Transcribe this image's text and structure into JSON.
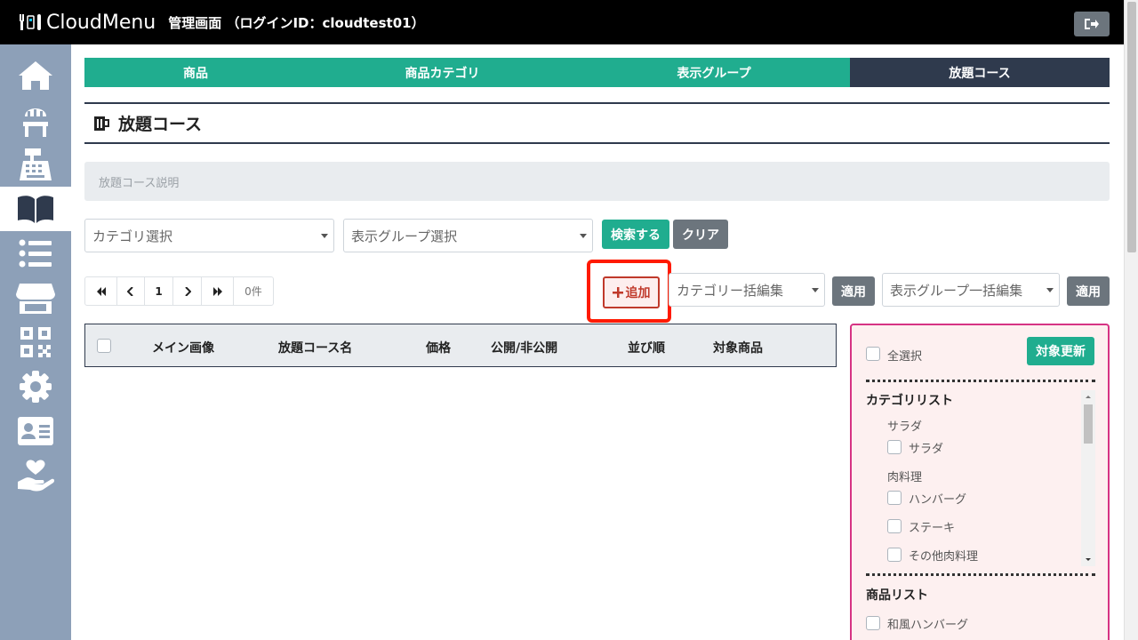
{
  "header": {
    "logo_text": "CloudMenu",
    "title": "管理画面 （ログインID：cloudtest01）"
  },
  "tabs": [
    {
      "label": "商品"
    },
    {
      "label": "商品カテゴリ"
    },
    {
      "label": "表示グループ"
    },
    {
      "label": "放題コース",
      "active": true
    }
  ],
  "page": {
    "title": "放題コース",
    "description_placeholder": "放題コース説明"
  },
  "filters": {
    "category_select": "カテゴリ選択",
    "group_select": "表示グループ選択",
    "search_button": "検索する",
    "clear_button": "クリア"
  },
  "pager": {
    "first": "«",
    "prev": "‹",
    "page": "1",
    "next": "›",
    "last": "»",
    "count": "0件"
  },
  "actions": {
    "add_button": "追加",
    "category_bulk": "カテゴリー括編集",
    "apply1": "適用",
    "group_bulk": "表示グループ一括編集",
    "apply2": "適用"
  },
  "table": {
    "columns": [
      "メイン画像",
      "放題コース名",
      "価格",
      "公開/非公開",
      "並び順",
      "対象商品"
    ]
  },
  "panel": {
    "select_all": "全選択",
    "update_button": "対象更新",
    "category_list_title": "カテゴリリスト",
    "groups": [
      {
        "name": "サラダ",
        "items": [
          "サラダ"
        ]
      },
      {
        "name": "肉料理",
        "items": [
          "ハンバーグ",
          "ステーキ",
          "その他肉料理"
        ]
      }
    ],
    "product_list_title": "商品リスト",
    "products": [
      "和風ハンバーグ"
    ]
  },
  "colors": {
    "accent": "#20ad8f",
    "dark": "#2f3a4d",
    "sidebar": "#8da0b8",
    "highlight": "#ff1a00"
  }
}
